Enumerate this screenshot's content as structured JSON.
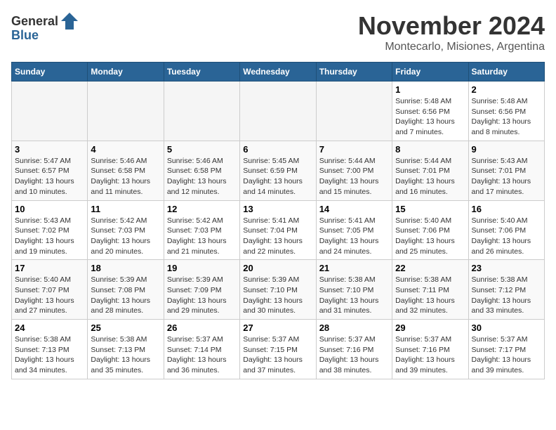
{
  "logo": {
    "text_general": "General",
    "text_blue": "Blue"
  },
  "title": {
    "month": "November 2024",
    "location": "Montecarlo, Misiones, Argentina"
  },
  "headers": [
    "Sunday",
    "Monday",
    "Tuesday",
    "Wednesday",
    "Thursday",
    "Friday",
    "Saturday"
  ],
  "weeks": [
    [
      {
        "day": "",
        "info": ""
      },
      {
        "day": "",
        "info": ""
      },
      {
        "day": "",
        "info": ""
      },
      {
        "day": "",
        "info": ""
      },
      {
        "day": "",
        "info": ""
      },
      {
        "day": "1",
        "info": "Sunrise: 5:48 AM\nSunset: 6:56 PM\nDaylight: 13 hours and 7 minutes."
      },
      {
        "day": "2",
        "info": "Sunrise: 5:48 AM\nSunset: 6:56 PM\nDaylight: 13 hours and 8 minutes."
      }
    ],
    [
      {
        "day": "3",
        "info": "Sunrise: 5:47 AM\nSunset: 6:57 PM\nDaylight: 13 hours and 10 minutes."
      },
      {
        "day": "4",
        "info": "Sunrise: 5:46 AM\nSunset: 6:58 PM\nDaylight: 13 hours and 11 minutes."
      },
      {
        "day": "5",
        "info": "Sunrise: 5:46 AM\nSunset: 6:58 PM\nDaylight: 13 hours and 12 minutes."
      },
      {
        "day": "6",
        "info": "Sunrise: 5:45 AM\nSunset: 6:59 PM\nDaylight: 13 hours and 14 minutes."
      },
      {
        "day": "7",
        "info": "Sunrise: 5:44 AM\nSunset: 7:00 PM\nDaylight: 13 hours and 15 minutes."
      },
      {
        "day": "8",
        "info": "Sunrise: 5:44 AM\nSunset: 7:01 PM\nDaylight: 13 hours and 16 minutes."
      },
      {
        "day": "9",
        "info": "Sunrise: 5:43 AM\nSunset: 7:01 PM\nDaylight: 13 hours and 17 minutes."
      }
    ],
    [
      {
        "day": "10",
        "info": "Sunrise: 5:43 AM\nSunset: 7:02 PM\nDaylight: 13 hours and 19 minutes."
      },
      {
        "day": "11",
        "info": "Sunrise: 5:42 AM\nSunset: 7:03 PM\nDaylight: 13 hours and 20 minutes."
      },
      {
        "day": "12",
        "info": "Sunrise: 5:42 AM\nSunset: 7:03 PM\nDaylight: 13 hours and 21 minutes."
      },
      {
        "day": "13",
        "info": "Sunrise: 5:41 AM\nSunset: 7:04 PM\nDaylight: 13 hours and 22 minutes."
      },
      {
        "day": "14",
        "info": "Sunrise: 5:41 AM\nSunset: 7:05 PM\nDaylight: 13 hours and 24 minutes."
      },
      {
        "day": "15",
        "info": "Sunrise: 5:40 AM\nSunset: 7:06 PM\nDaylight: 13 hours and 25 minutes."
      },
      {
        "day": "16",
        "info": "Sunrise: 5:40 AM\nSunset: 7:06 PM\nDaylight: 13 hours and 26 minutes."
      }
    ],
    [
      {
        "day": "17",
        "info": "Sunrise: 5:40 AM\nSunset: 7:07 PM\nDaylight: 13 hours and 27 minutes."
      },
      {
        "day": "18",
        "info": "Sunrise: 5:39 AM\nSunset: 7:08 PM\nDaylight: 13 hours and 28 minutes."
      },
      {
        "day": "19",
        "info": "Sunrise: 5:39 AM\nSunset: 7:09 PM\nDaylight: 13 hours and 29 minutes."
      },
      {
        "day": "20",
        "info": "Sunrise: 5:39 AM\nSunset: 7:10 PM\nDaylight: 13 hours and 30 minutes."
      },
      {
        "day": "21",
        "info": "Sunrise: 5:38 AM\nSunset: 7:10 PM\nDaylight: 13 hours and 31 minutes."
      },
      {
        "day": "22",
        "info": "Sunrise: 5:38 AM\nSunset: 7:11 PM\nDaylight: 13 hours and 32 minutes."
      },
      {
        "day": "23",
        "info": "Sunrise: 5:38 AM\nSunset: 7:12 PM\nDaylight: 13 hours and 33 minutes."
      }
    ],
    [
      {
        "day": "24",
        "info": "Sunrise: 5:38 AM\nSunset: 7:13 PM\nDaylight: 13 hours and 34 minutes."
      },
      {
        "day": "25",
        "info": "Sunrise: 5:38 AM\nSunset: 7:13 PM\nDaylight: 13 hours and 35 minutes."
      },
      {
        "day": "26",
        "info": "Sunrise: 5:37 AM\nSunset: 7:14 PM\nDaylight: 13 hours and 36 minutes."
      },
      {
        "day": "27",
        "info": "Sunrise: 5:37 AM\nSunset: 7:15 PM\nDaylight: 13 hours and 37 minutes."
      },
      {
        "day": "28",
        "info": "Sunrise: 5:37 AM\nSunset: 7:16 PM\nDaylight: 13 hours and 38 minutes."
      },
      {
        "day": "29",
        "info": "Sunrise: 5:37 AM\nSunset: 7:16 PM\nDaylight: 13 hours and 39 minutes."
      },
      {
        "day": "30",
        "info": "Sunrise: 5:37 AM\nSunset: 7:17 PM\nDaylight: 13 hours and 39 minutes."
      }
    ]
  ]
}
